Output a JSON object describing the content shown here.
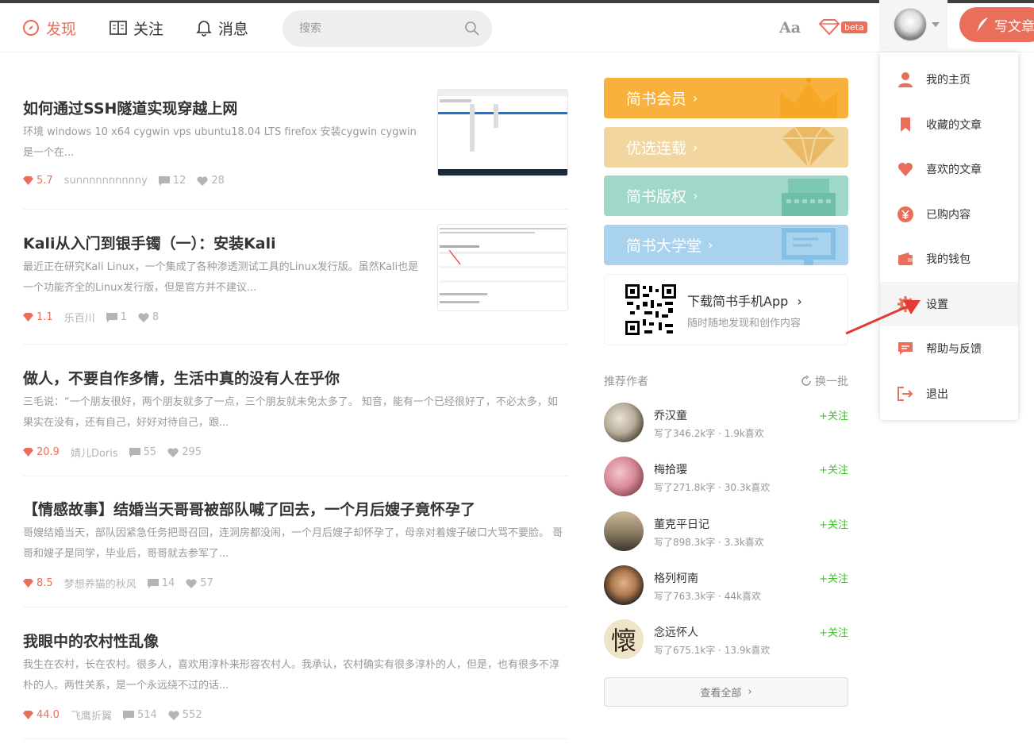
{
  "nav": {
    "discover": "发现",
    "follow": "关注",
    "messages": "消息",
    "search_placeholder": "搜索",
    "font_toggle": "Aa",
    "beta": "beta",
    "write": "写文章"
  },
  "articles": [
    {
      "title": "如何通过SSH隧道实现穿越上网",
      "abstract": "环境 windows 10 x64 cygwin vps ubuntu18.04 LTS firefox 安装cygwin cygwin是一个在...",
      "score": "5.7",
      "author": "sunnnnnnnnnny",
      "comments": "12",
      "likes": "28"
    },
    {
      "title": "Kali从入门到银手镯（一）：安装Kali",
      "abstract": "最近正在研究Kali Linux，一个集成了各种渗透测试工具的Linux发行版。虽然Kali也是一个功能齐全的Linux发行版，但是官方并不建议...",
      "score": "1.1",
      "author": "乐百川",
      "comments": "1",
      "likes": "8"
    },
    {
      "title": "做人，不要自作多情，生活中真的没有人在乎你",
      "abstract": "三毛说：“一个朋友很好，两个朋友就多了一点，三个朋友就未免太多了。 知音，能有一个已经很好了，不必太多，如果实在没有，还有自己，好好对待自己，跟...",
      "score": "20.9",
      "author": "婧儿Doris",
      "comments": "55",
      "likes": "295"
    },
    {
      "title": "【情感故事】结婚当天哥哥被部队喊了回去，一个月后嫂子竟怀孕了",
      "abstract": "哥嫂结婚当天，部队因紧急任务把哥召回，连洞房都没闹，一个月后嫂子却怀孕了，母亲对着嫂子破口大骂不要脸。 哥哥和嫂子是同学，毕业后，哥哥就去参军了...",
      "score": "8.5",
      "author": "梦想养猫的秋风",
      "comments": "14",
      "likes": "57"
    },
    {
      "title": "我眼中的农村性乱像",
      "abstract": "我生在农村，长在农村。很多人，喜欢用淳朴来形容农村人。我承认，农村确实有很多淳朴的人，但是，也有很多不淳朴的人。两性关系，是一个永远绕不过的话...",
      "score": "44.0",
      "author": "飞鹰折翼",
      "comments": "514",
      "likes": "552"
    }
  ],
  "banners": [
    {
      "label": "简书会员",
      "color": "#f8b13d"
    },
    {
      "label": "优选连载",
      "color": "#f2d69f"
    },
    {
      "label": "简书版权",
      "color": "#9fd8c8"
    },
    {
      "label": "简书大学堂",
      "color": "#a8d2ee"
    }
  ],
  "app": {
    "title": "下载简书手机App",
    "subtitle": "随时随地发现和创作内容"
  },
  "recommend": {
    "title": "推荐作者",
    "refresh": "换一批",
    "follow_label": "+关注",
    "see_all": "查看全部",
    "authors": [
      {
        "name": "乔汉童",
        "stat": "写了346.2k字 · 1.9k喜欢"
      },
      {
        "name": "梅拾璎",
        "stat": "写了271.8k字 · 30.3k喜欢"
      },
      {
        "name": "董克平日记",
        "stat": "写了898.3k字 · 3.3k喜欢"
      },
      {
        "name": "格列柯南",
        "stat": "写了763.3k字 · 44k喜欢"
      },
      {
        "name": "念远怀人",
        "stat": "写了675.1k字 · 13.9k喜欢"
      }
    ]
  },
  "dropdown": {
    "items": [
      {
        "label": "我的主页",
        "icon": "user-icon"
      },
      {
        "label": "收藏的文章",
        "icon": "bookmark-icon"
      },
      {
        "label": "喜欢的文章",
        "icon": "heart-icon"
      },
      {
        "label": "已购内容",
        "icon": "yen-icon"
      },
      {
        "label": "我的钱包",
        "icon": "wallet-icon"
      },
      {
        "label": "设置",
        "icon": "gear-icon"
      },
      {
        "label": "帮助与反馈",
        "icon": "feedback-icon"
      },
      {
        "label": "退出",
        "icon": "logout-icon"
      }
    ]
  },
  "colors": {
    "accent": "#ea6f5a",
    "follow": "#42c02e"
  }
}
